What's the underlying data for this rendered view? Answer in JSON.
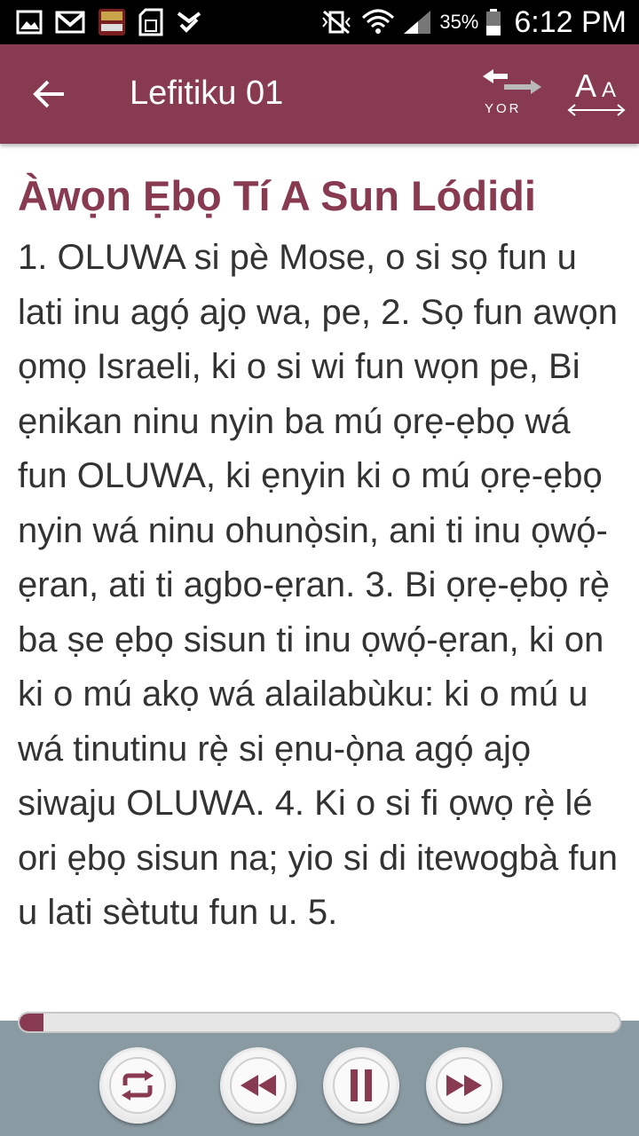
{
  "status_bar": {
    "battery_percent": "35%",
    "time": "6:12 PM",
    "icons_left": [
      "gallery-icon",
      "gmail-icon",
      "yoruba-bible-app-icon",
      "sd-card-icon",
      "download-done-icon"
    ],
    "icons_right": [
      "vibrate-silent-icon",
      "wifi-icon",
      "signal-icon",
      "battery-icon"
    ]
  },
  "app_bar": {
    "title": "Lefitiku 01",
    "language_label": "YOR",
    "font_size_label_big": "A",
    "font_size_label_small": "A",
    "background_color": "#883a51"
  },
  "content": {
    "heading": "Àwọn Ẹbọ Tí A Sun Lódidi",
    "text": "1. OLUWA si pè Mose, o si sọ fun u lati inu agọ́ ajọ wa, pe, 2. Sọ fun awọn ọmọ Israeli, ki o si wi fun wọn pe, Bi ẹnikan ninu nyin ba mú ọrẹ-ẹbọ wá fun OLUWA, ki ẹnyin ki o mú ọrẹ-ẹbọ nyin wá ninu ohunọ̀sin, ani ti inu ọwọ́-ẹran, ati ti agbo-ẹran. 3. Bi ọrẹ-ẹbọ rẹ̀ ba ṣe ẹbọ sisun ti inu ọwọ́-ẹran, ki on ki o mú akọ wá alailabùku: ki o mú u wá tinutinu rẹ̀ si ẹnu-ọ̀na agọ́ ajọ siwaju OLUWA. 4. Ki o si fi ọwọ rẹ̀ lé ori ẹbọ sisun na; yio si di itewogbà fun u lati sètutu fun u. 5."
  },
  "player": {
    "progress": 0.04,
    "buttons": [
      "repeat",
      "rewind",
      "pause",
      "fast-forward"
    ],
    "accent_color": "#883a51"
  }
}
